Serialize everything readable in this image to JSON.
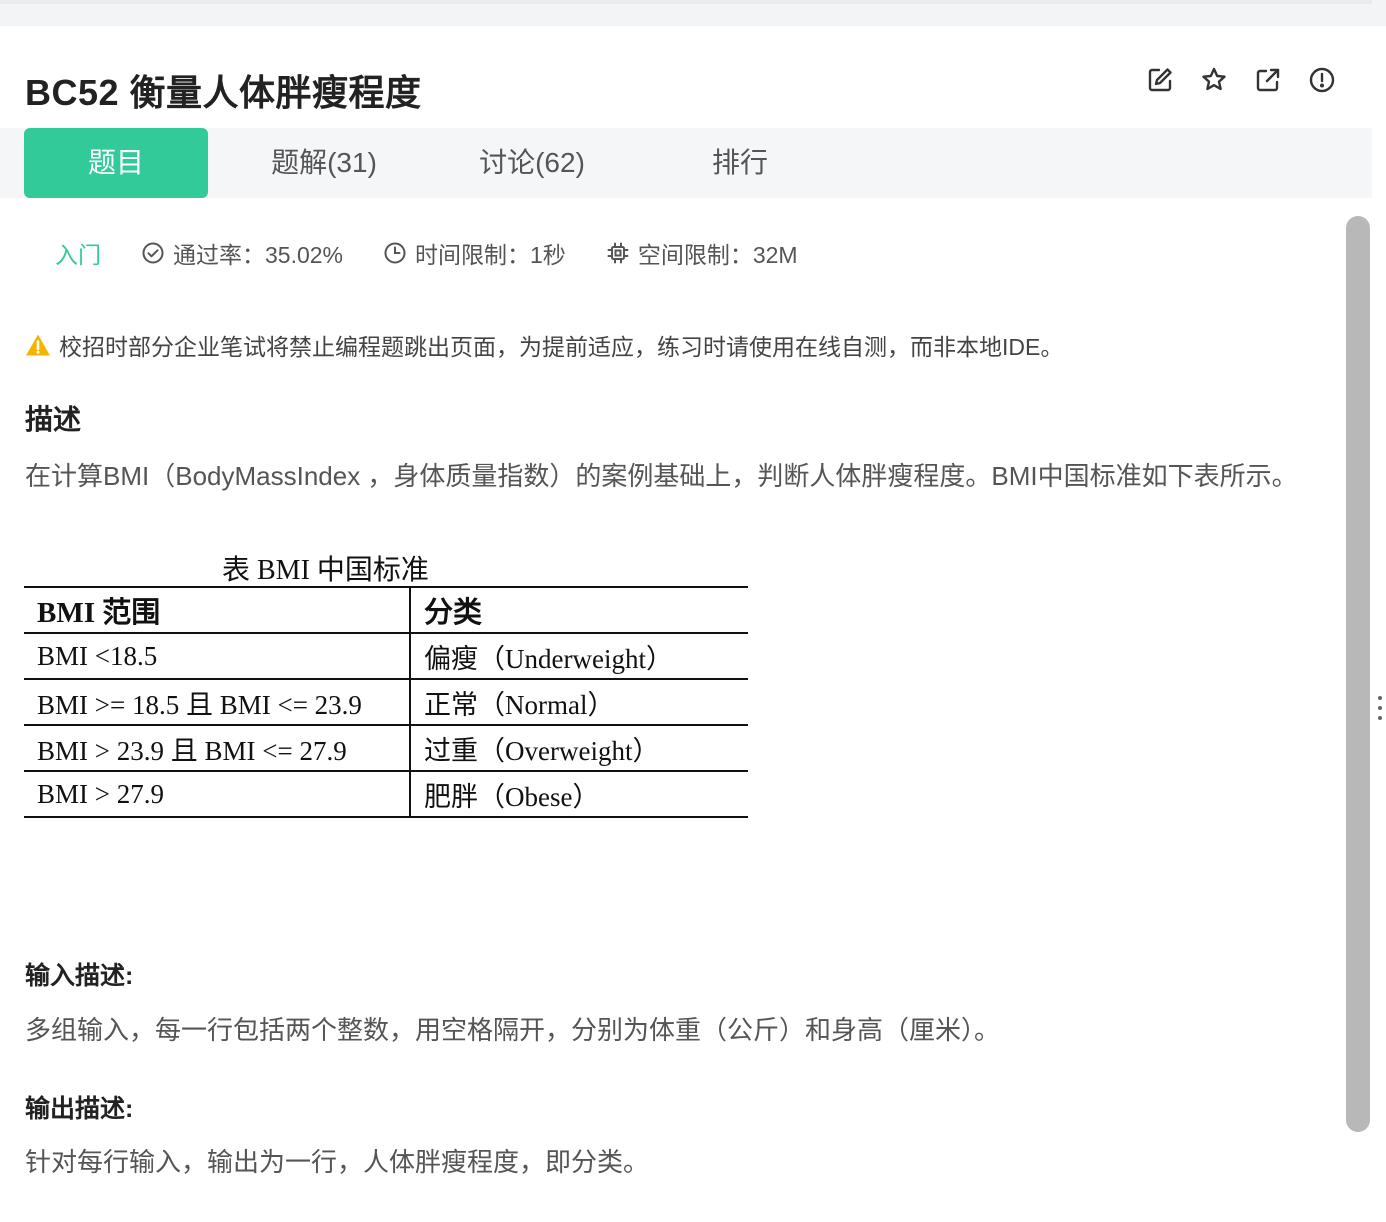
{
  "problem": {
    "title": "BC52  衡量人体胖瘦程度",
    "header_icons": [
      "edit-icon",
      "star-icon",
      "share-icon",
      "report-icon"
    ]
  },
  "tabs": [
    {
      "label": "题目",
      "active": true
    },
    {
      "label": "题解(31)",
      "active": false
    },
    {
      "label": "讨论(62)",
      "active": false
    },
    {
      "label": "排行",
      "active": false
    }
  ],
  "meta": {
    "level": "入门",
    "pass_rate": "通过率：35.02%",
    "time_limit": "时间限制：1秒",
    "space_limit": "空间限制：32M"
  },
  "warning": "校招时部分企业笔试将禁止编程题跳出页面，为提前适应，练习时请使用在线自测，而非本地IDE。",
  "description": {
    "title": "描述",
    "text": "在计算BMI（BodyMassIndex ，身体质量指数）的案例基础上，判断人体胖瘦程度。BMI中国标准如下表所示。",
    "table_caption": "表 BMI 中国标准",
    "table_headers": [
      "BMI 范围",
      "分类"
    ],
    "table_rows": [
      [
        "BMI <18.5",
        "偏瘦（Underweight）"
      ],
      [
        "BMI >= 18.5 且 BMI <= 23.9",
        "正常（Normal）"
      ],
      [
        "BMI > 23.9 且 BMI <= 27.9",
        "过重（Overweight）"
      ],
      [
        "BMI > 27.9",
        "肥胖（Obese）"
      ]
    ]
  },
  "input_desc": {
    "title": "输入描述:",
    "text": "多组输入，每一行包括两个整数，用空格隔开，分别为体重（公斤）和身高（厘米）。"
  },
  "output_desc": {
    "title": "输出描述:",
    "text": "针对每行输入，输出为一行，人体胖瘦程度，即分类。"
  },
  "colors": {
    "accent": "#32ca99",
    "warning": "#f5b400"
  }
}
